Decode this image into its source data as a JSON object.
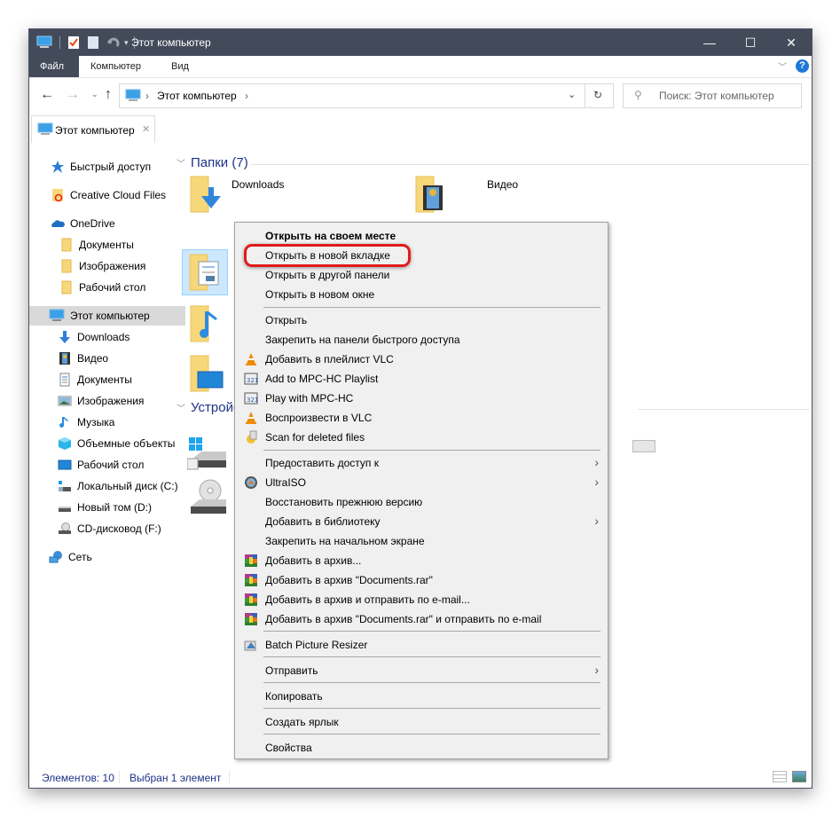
{
  "window": {
    "title": "Этот компьютер",
    "controls": {
      "minimize": "—",
      "maximize": "☐",
      "close": "✕"
    }
  },
  "ribbon": {
    "tabs": [
      {
        "label": "Файл"
      },
      {
        "label": "Компьютер"
      },
      {
        "label": "Вид"
      }
    ],
    "help_icon": "?"
  },
  "address": {
    "path": [
      "Этот компьютер"
    ],
    "search_placeholder": "Поиск: Этот компьютер"
  },
  "tab": {
    "label": "Этот компьютер",
    "close": "✕"
  },
  "sidebar": {
    "items": [
      {
        "label": "Быстрый доступ",
        "icon": "star-icon"
      },
      {
        "label": "Creative Cloud Files",
        "icon": "creative-cloud-icon"
      },
      {
        "label": "OneDrive",
        "icon": "onedrive-cloud-icon"
      },
      {
        "label": "Документы",
        "icon": "folder-icon"
      },
      {
        "label": "Изображения",
        "icon": "folder-icon"
      },
      {
        "label": "Рабочий стол",
        "icon": "folder-icon"
      },
      {
        "label": "Этот компьютер",
        "icon": "computer-icon",
        "selected": true
      },
      {
        "label": "Downloads",
        "icon": "download-arrow-icon"
      },
      {
        "label": "Видео",
        "icon": "video-icon"
      },
      {
        "label": "Документы",
        "icon": "document-icon"
      },
      {
        "label": "Изображения",
        "icon": "pictures-icon"
      },
      {
        "label": "Музыка",
        "icon": "music-icon"
      },
      {
        "label": "Объемные объекты",
        "icon": "3d-objects-icon"
      },
      {
        "label": "Рабочий стол",
        "icon": "desktop-icon"
      },
      {
        "label": "Локальный диск (C:)",
        "icon": "system-drive-icon"
      },
      {
        "label": "Новый том (D:)",
        "icon": "drive-icon"
      },
      {
        "label": "CD-дисковод (F:)",
        "icon": "cd-drive-icon"
      },
      {
        "label": "Сеть",
        "icon": "network-icon"
      }
    ]
  },
  "content": {
    "folders_header": "Папки (7)",
    "devices_header": "Устройства и диски",
    "folders": [
      {
        "label": "Downloads"
      },
      {
        "label": "Видео"
      }
    ]
  },
  "context_menu": {
    "items": [
      {
        "label": "Открыть на своем месте",
        "bold": true
      },
      {
        "label": "Открыть в новой вкладке",
        "highlighted": true
      },
      {
        "label": "Открыть в другой панели"
      },
      {
        "label": "Открыть в новом окне"
      },
      {
        "label": "Открыть"
      },
      {
        "label": "Закрепить на панели быстрого доступа"
      },
      {
        "label": "Добавить в плейлист VLC",
        "icon": "vlc-icon"
      },
      {
        "label": "Add to MPC-HC Playlist",
        "icon": "mpc-hc-icon"
      },
      {
        "label": "Play with MPC-HC",
        "icon": "mpc-hc-icon"
      },
      {
        "label": "Воспроизвести в VLC",
        "icon": "vlc-icon"
      },
      {
        "label": "Scan for deleted files",
        "icon": "scan-icon"
      },
      {
        "label": "Предоставить доступ к",
        "submenu": true
      },
      {
        "label": "UltraISO",
        "icon": "ultraiso-icon",
        "submenu": true
      },
      {
        "label": "Восстановить прежнюю версию"
      },
      {
        "label": "Добавить в библиотеку",
        "submenu": true
      },
      {
        "label": "Закрепить на начальном экране"
      },
      {
        "label": "Добавить в архив...",
        "icon": "winrar-icon"
      },
      {
        "label": "Добавить в архив \"Documents.rar\"",
        "icon": "winrar-icon"
      },
      {
        "label": "Добавить в архив и отправить по e-mail...",
        "icon": "winrar-icon"
      },
      {
        "label": "Добавить в архив \"Documents.rar\" и отправить по e-mail",
        "icon": "winrar-icon"
      },
      {
        "label": "Batch Picture Resizer",
        "icon": "batch-resizer-icon"
      },
      {
        "label": "Отправить",
        "submenu": true
      },
      {
        "label": "Копировать"
      },
      {
        "label": "Создать ярлык"
      },
      {
        "label": "Свойства"
      }
    ],
    "submenu_arrow": "›"
  },
  "status": {
    "count": "Элементов: 10",
    "selected": "Выбран 1 элемент"
  },
  "colors": {
    "titlebar": "#434b5b",
    "accent_text": "#1e3287",
    "highlight_ring": "#e31a1a",
    "selection": "#cce8ff"
  }
}
